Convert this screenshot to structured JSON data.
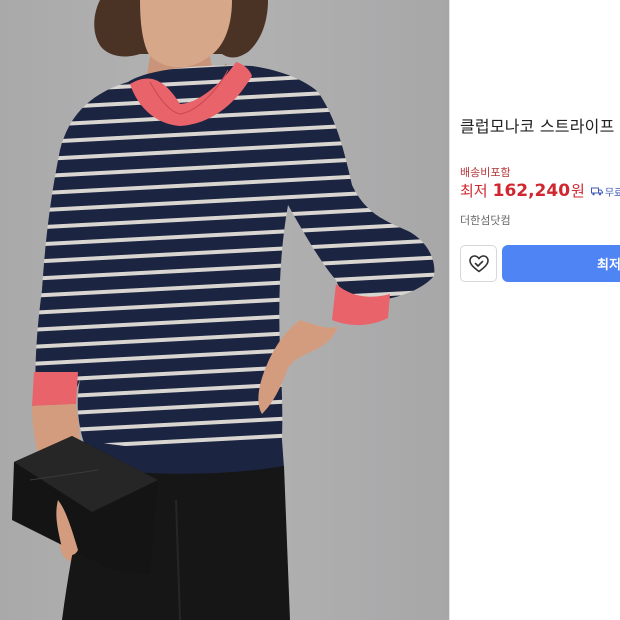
{
  "product": {
    "image_alt_name": "striped-sweater-photo",
    "title": "클럽모나코 스트라이프 스",
    "shipping_note": "배송비포함",
    "price_prefix": "최저",
    "price_value": "162,240",
    "price_unit": "원",
    "delivery_label": "무료",
    "seller": "더한섬닷컴",
    "buy_label": "최저",
    "wish_icon": "heart-check-icon",
    "delivery_icon": "truck-icon"
  },
  "colors": {
    "price": "#d0262f",
    "shipping": "#b4373a",
    "buy_button": "#4f84f4",
    "delivery": "#3d5ab8",
    "sweater_navy": "#1b2440",
    "sweater_stripe": "#d9d6d2",
    "cuff_coral": "#e8646a"
  }
}
